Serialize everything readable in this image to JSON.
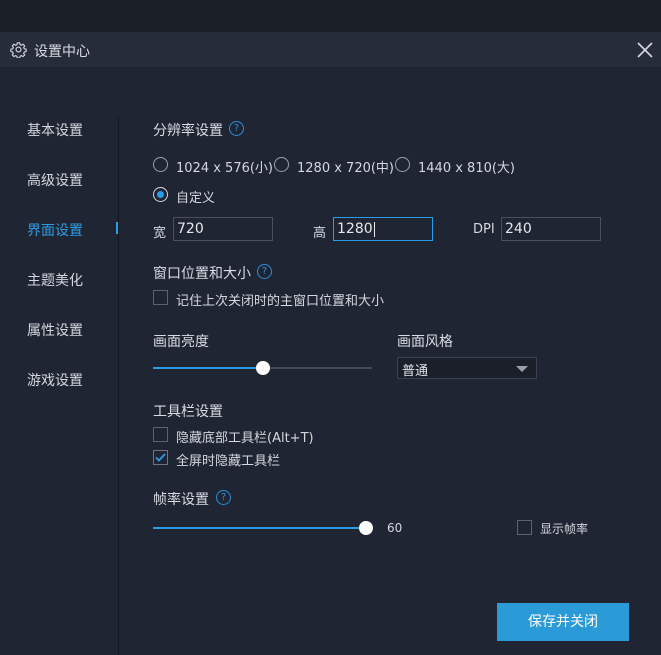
{
  "window": {
    "title": "设置中心"
  },
  "sidebar": {
    "items": [
      {
        "label": "基本设置"
      },
      {
        "label": "高级设置"
      },
      {
        "label": "界面设置",
        "active": true
      },
      {
        "label": "主题美化"
      },
      {
        "label": "属性设置"
      },
      {
        "label": "游戏设置"
      }
    ]
  },
  "resolution": {
    "title": "分辨率设置",
    "help": "?",
    "options": [
      {
        "label": "1024 x 576(小)",
        "checked": false
      },
      {
        "label": "1280 x 720(中)",
        "checked": false
      },
      {
        "label": "1440 x 810(大)",
        "checked": false
      },
      {
        "label": "自定义",
        "checked": true
      }
    ],
    "width_label": "宽",
    "width_value": "720",
    "height_label": "高",
    "height_value": "1280",
    "dpi_label": "DPI",
    "dpi_value": "240"
  },
  "window_pos": {
    "title": "窗口位置和大小",
    "help": "?",
    "remember_label": "记住上次关闭时的主窗口位置和大小",
    "remember_checked": false
  },
  "brightness": {
    "title": "画面亮度",
    "level_fraction": 0.5
  },
  "style": {
    "title": "画面风格",
    "selected": "普通"
  },
  "toolbar": {
    "title": "工具栏设置",
    "hide_bottom_label": "隐藏底部工具栏(Alt+T)",
    "hide_bottom_checked": false,
    "hide_fullscreen_label": "全屏时隐藏工具栏",
    "hide_fullscreen_checked": true
  },
  "framerate": {
    "title": "帧率设置",
    "help": "?",
    "value": "60",
    "level_fraction": 1.0,
    "show_fps_label": "显示帧率",
    "show_fps_checked": false
  },
  "footer": {
    "save_label": "保存并关闭"
  },
  "colors": {
    "accent": "#2b9de6",
    "background": "#1f2532",
    "titlebar": "#262c3a",
    "button": "#2b9bd8"
  }
}
